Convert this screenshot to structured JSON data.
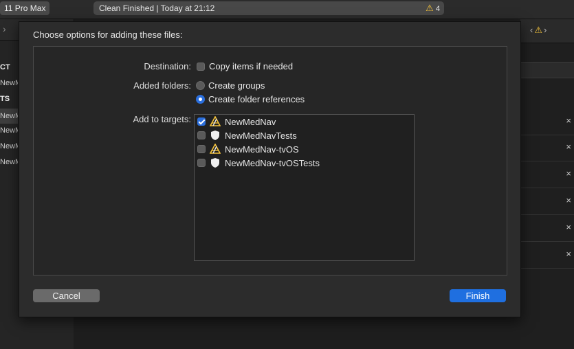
{
  "toolbar": {
    "scheme": "11 Pro Max",
    "activity": "Clean Finished | Today at 21:12",
    "warning_count": "4"
  },
  "navigator": {
    "rows": [
      {
        "label": "CT",
        "header": true
      },
      {
        "label": "NewMedNav",
        "header": false
      },
      {
        "label": "TS",
        "header": true
      },
      {
        "label": "NewMedNav",
        "header": false,
        "selected": true
      },
      {
        "label": "NewMedNavTests",
        "header": false
      },
      {
        "label": "NewMedNav-tvOS",
        "header": false
      },
      {
        "label": "NewMedNav-tvOSTests",
        "header": false
      }
    ]
  },
  "sheet": {
    "title": "Choose options for adding these files:",
    "destination_label": "Destination:",
    "copy_items_label": "Copy items if needed",
    "copy_items_checked": false,
    "added_folders_label": "Added folders:",
    "create_groups_label": "Create groups",
    "create_folder_refs_label": "Create folder references",
    "selected_folder_option": "Create folder references",
    "add_to_targets_label": "Add to targets:",
    "targets": [
      {
        "name": "NewMedNav",
        "checked": true,
        "icon": "app-icon"
      },
      {
        "name": "NewMedNavTests",
        "checked": false,
        "icon": "test-bundle-icon"
      },
      {
        "name": "NewMedNav-tvOS",
        "checked": false,
        "icon": "app-icon"
      },
      {
        "name": "NewMedNav-tvOSTests",
        "checked": false,
        "icon": "test-bundle-icon"
      }
    ],
    "cancel_label": "Cancel",
    "finish_label": "Finish"
  },
  "colors": {
    "accent": "#1f6fe0",
    "warning": "#f5c33b"
  }
}
